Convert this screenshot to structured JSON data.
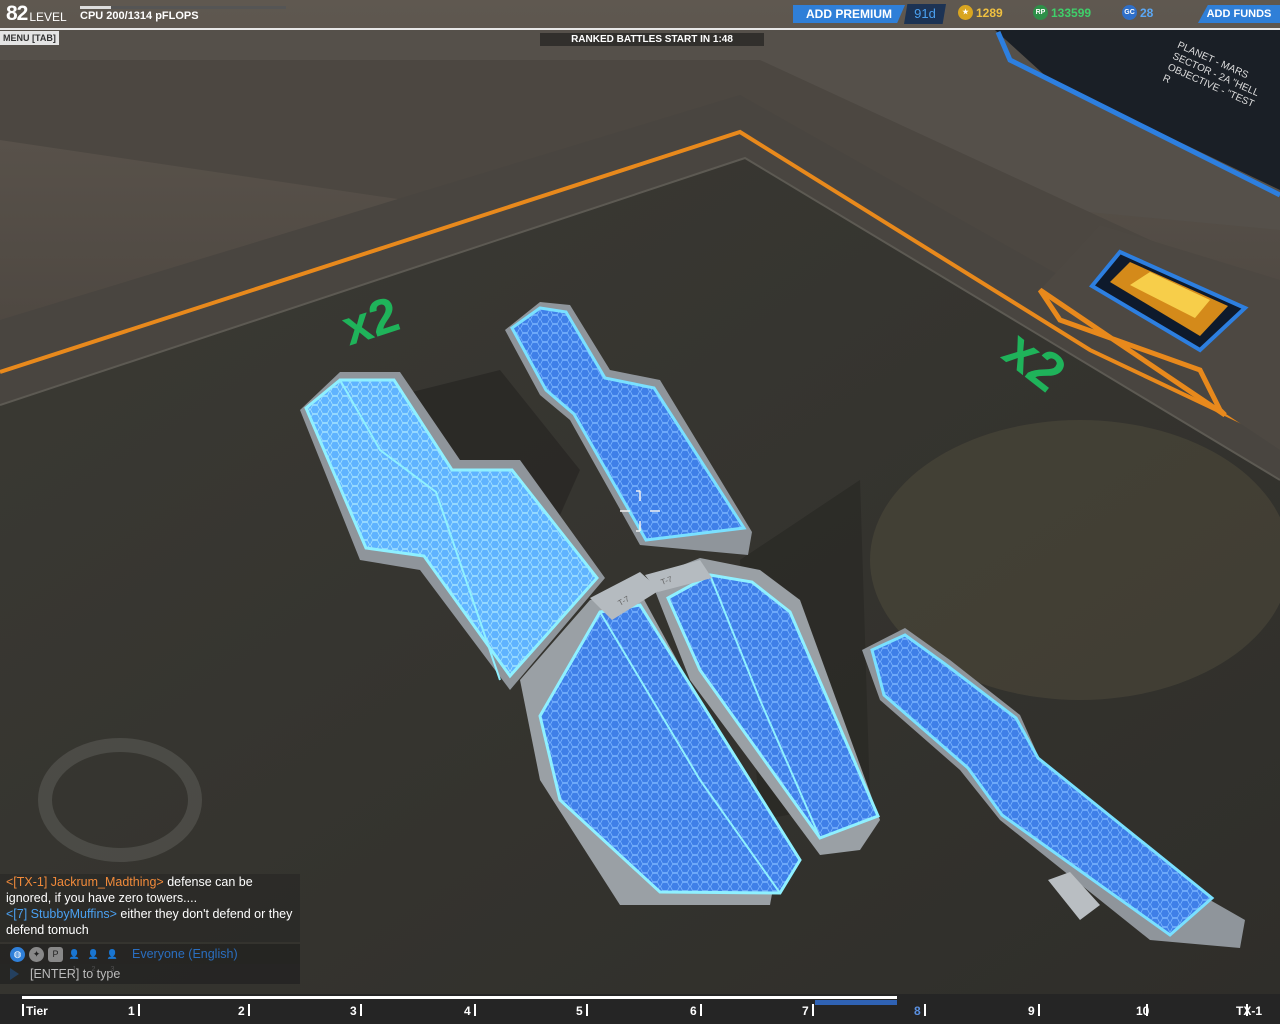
{
  "hud": {
    "level_number": "82",
    "level_label": "LEVEL",
    "cpu_text": "CPU 200/1314 pFLOPS",
    "cpu_fraction": 0.152,
    "menu_label": "MENU [TAB]",
    "ranked_text": "RANKED BATTLES START IN 1:48",
    "add_premium_label": "ADD PREMIUM",
    "premium_days": "91d",
    "tech_points": "1289",
    "robits": "133599",
    "galaxy_coins": "28",
    "add_funds_label": "ADD FUNDS",
    "rp_badge": "RP",
    "gc_badge": "GC"
  },
  "planet_info": {
    "line1": "PLANET - MARS",
    "line2": "SECTOR - 2A \"HELL",
    "line3": "OBJECTIVE - \"TEST R"
  },
  "scene": {
    "multiplier_left": "x2",
    "multiplier_right": "x2",
    "block_label_1": "T-7",
    "block_label_2": "T-7"
  },
  "chat": {
    "messages": [
      {
        "sender": "<[TX-1] Jackrum_Madthing>",
        "sender_color": "#f08a3a",
        "text": " defense can be ignored, if you have zero towers...."
      },
      {
        "sender": "<[7] StubbyMuffins>",
        "sender_color": "#4aa0f0",
        "text": " either they don't defend or they defend tomuch"
      }
    ],
    "channel": "Everyone (English)",
    "input_placeholder": "[ENTER] to type",
    "party_count_1": "1",
    "party_count_2": "2",
    "party_count_3": "3",
    "party_letter": "P"
  },
  "tiers": {
    "progress_fraction": 0.697,
    "labels": [
      "Tier",
      "1",
      "2",
      "3",
      "4",
      "5",
      "6",
      "7",
      "8",
      "9",
      "10",
      "TX-1"
    ],
    "current": "8"
  },
  "colors": {
    "accent_blue": "#2f7fd8",
    "orange_trim": "#e8891c",
    "cube_blue": "#4a8cff",
    "cube_glow": "#7fe6ff",
    "multiplier_green": "#1fb35a"
  }
}
